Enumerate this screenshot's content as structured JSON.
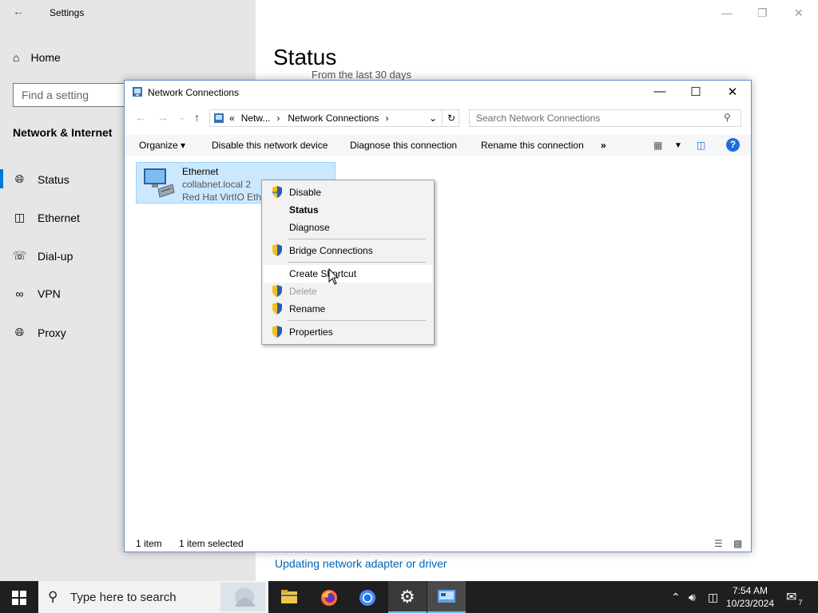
{
  "settings": {
    "title": "Settings",
    "home": "Home",
    "find_placeholder": "Find a setting",
    "category": "Network & Internet",
    "nav": [
      {
        "label": "Status",
        "icon": "globe-icon"
      },
      {
        "label": "Ethernet",
        "icon": "ethernet-icon"
      },
      {
        "label": "Dial-up",
        "icon": "dialup-icon"
      },
      {
        "label": "VPN",
        "icon": "vpn-icon"
      },
      {
        "label": "Proxy",
        "icon": "globe-icon"
      }
    ],
    "heading": "Status",
    "subtext": "From the last 30 days",
    "link": "Updating network adapter or driver"
  },
  "nc": {
    "title": "Network Connections",
    "address": {
      "prefix": "«",
      "crumb1": "Netw...",
      "crumb2": "Network Connections"
    },
    "search_placeholder": "Search Network Connections",
    "commands": {
      "organize": "Organize",
      "disable": "Disable this network device",
      "diagnose": "Diagnose this connection",
      "rename": "Rename this connection",
      "more": "»"
    },
    "help": "?",
    "item": {
      "name": "Ethernet",
      "line2": "collabnet.local 2",
      "line3": "Red Hat VirtIO Ethernet Adapter"
    },
    "status": {
      "count": "1 item",
      "selected": "1 item selected"
    }
  },
  "context_menu": {
    "items": [
      {
        "label": "Disable",
        "shield": true
      },
      {
        "label": "Status",
        "bold": true
      },
      {
        "label": "Diagnose"
      },
      {
        "label": "Bridge Connections",
        "shield": true
      },
      {
        "label": "Create Shortcut",
        "hover": true
      },
      {
        "label": "Delete",
        "shield": true,
        "disabled": true
      },
      {
        "label": "Rename",
        "shield": true
      },
      {
        "label": "Properties",
        "shield": true
      }
    ]
  },
  "taskbar": {
    "search_placeholder": "Type here to search",
    "time": "7:54 AM",
    "date": "10/23/2024",
    "notification_count": "7"
  },
  "colors": {
    "accent": "#0078d7",
    "selection": "#cce8ff",
    "taskbar": "#1f1f1f"
  }
}
